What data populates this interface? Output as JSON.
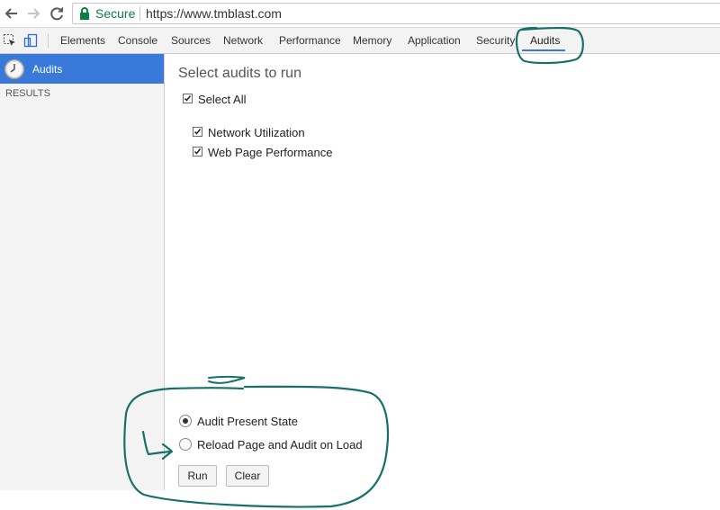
{
  "browser": {
    "secure_label": "Secure",
    "url": "https://www.tmblast.com"
  },
  "devtools": {
    "tabs": [
      {
        "label": "Elements"
      },
      {
        "label": "Console"
      },
      {
        "label": "Sources"
      },
      {
        "label": "Network"
      },
      {
        "label": "Performance"
      },
      {
        "label": "Memory"
      },
      {
        "label": "Application"
      },
      {
        "label": "Security"
      },
      {
        "label": "Audits",
        "active": true
      }
    ],
    "accent_color": "#3879d9"
  },
  "sidebar": {
    "selected_item": "Audits",
    "results_label": "RESULTS"
  },
  "audits": {
    "title": "Select audits to run",
    "select_all_label": "Select All",
    "categories": [
      {
        "label": "Network Utilization",
        "checked": true
      },
      {
        "label": "Web Page Performance",
        "checked": true
      }
    ],
    "modes": [
      {
        "label": "Audit Present State",
        "selected": true
      },
      {
        "label": "Reload Page and Audit on Load",
        "selected": false
      }
    ],
    "run_label": "Run",
    "clear_label": "Clear"
  },
  "annotation_color": "#17706a"
}
